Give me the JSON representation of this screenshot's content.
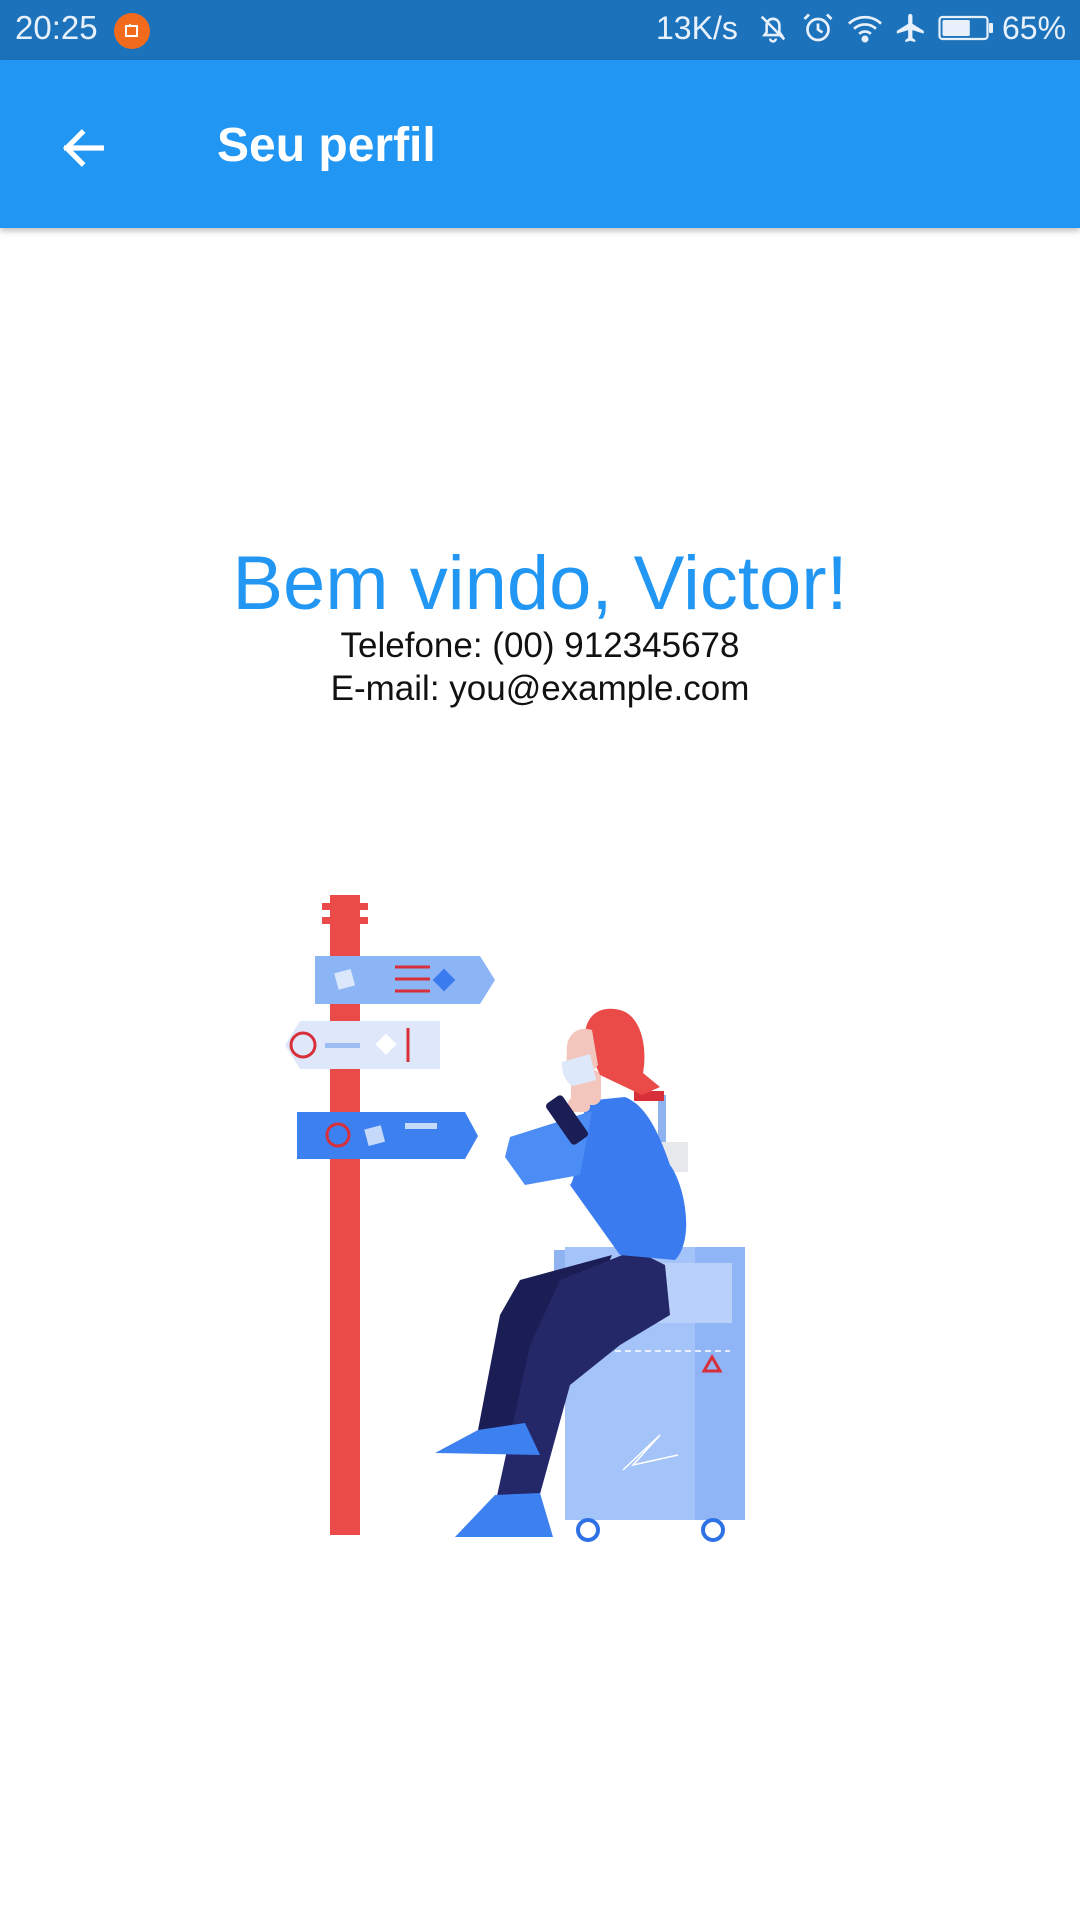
{
  "status_bar": {
    "time": "20:25",
    "network_speed": "13K/s",
    "battery_percent": "65%",
    "battery_level": 0.65,
    "icons": [
      "notification-app-icon",
      "bell-muted-icon",
      "alarm-icon",
      "wifi-icon",
      "airplane-icon",
      "battery-icon"
    ]
  },
  "app_bar": {
    "title": "Seu perfil",
    "back_icon": "arrow-left-icon",
    "color": "#2196f3"
  },
  "profile": {
    "welcome": "Bem vindo, Victor!",
    "phone": "Telefone: (00) 912345678",
    "email": "E-mail: you@example.com"
  },
  "colors": {
    "accent": "#2196f3",
    "status_bar": "#1c73bc",
    "illustration_red": "#ea4b48",
    "illustration_navy": "#1f2160"
  }
}
